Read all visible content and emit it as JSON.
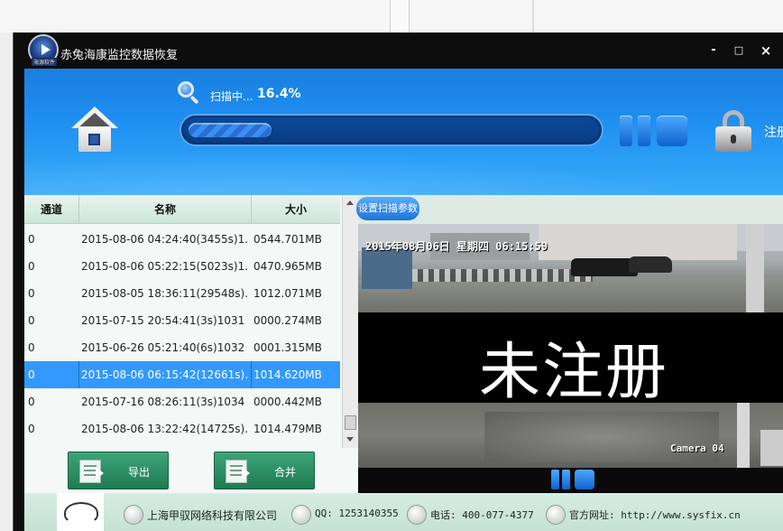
{
  "window": {
    "title": "赤兔海康监控数据恢复",
    "logo_caption": "海源软件",
    "minimize": "-",
    "maximize": "□",
    "close": "×"
  },
  "header": {
    "scan_label": "扫描中...",
    "scan_percent": "16.4%",
    "progress_fraction": 0.164,
    "register_label": "注册"
  },
  "table": {
    "columns": [
      "通道",
      "名称",
      "大小"
    ],
    "rows": [
      {
        "channel": "0",
        "name": "2015-08-06 04:24:40(3455s)1...",
        "size": "0544.701MB",
        "selected": false
      },
      {
        "channel": "0",
        "name": "2015-08-06 05:22:15(5023s)1...",
        "size": "0470.965MB",
        "selected": false
      },
      {
        "channel": "0",
        "name": "2015-08-05 18:36:11(29548s)...",
        "size": "1012.071MB",
        "selected": false
      },
      {
        "channel": "0",
        "name": "2015-07-15 20:54:41(3s)1031",
        "size": "0000.274MB",
        "selected": false
      },
      {
        "channel": "0",
        "name": "2015-06-26 05:21:40(6s)1032",
        "size": "0001.315MB",
        "selected": false
      },
      {
        "channel": "0",
        "name": "2015-08-06 06:15:42(12661s)...",
        "size": "1014.620MB",
        "selected": true
      },
      {
        "channel": "0",
        "name": "2015-07-16 08:26:11(3s)1034",
        "size": "0000.442MB",
        "selected": false
      },
      {
        "channel": "0",
        "name": "2015-08-06 13:22:42(14725s)...",
        "size": "1014.479MB",
        "selected": false
      }
    ]
  },
  "buttons": {
    "export": "导出",
    "merge": "合并"
  },
  "preview": {
    "settings_button": "设置扫描参数",
    "timestamp": "2015年08月06日 星期四 06:15:59",
    "watermark": "未注册",
    "camera_label": "Camera 04"
  },
  "footer": {
    "company": "上海甲驭网络科技有限公司",
    "qq": "QQ: 1253140355",
    "phone": "电话: 400-077-4377",
    "website": "官方网址: http://www.sysfix.cn"
  },
  "colors": {
    "accent": "#1e8cee",
    "selection": "#3399ff",
    "button_green": "#2e8f63"
  }
}
